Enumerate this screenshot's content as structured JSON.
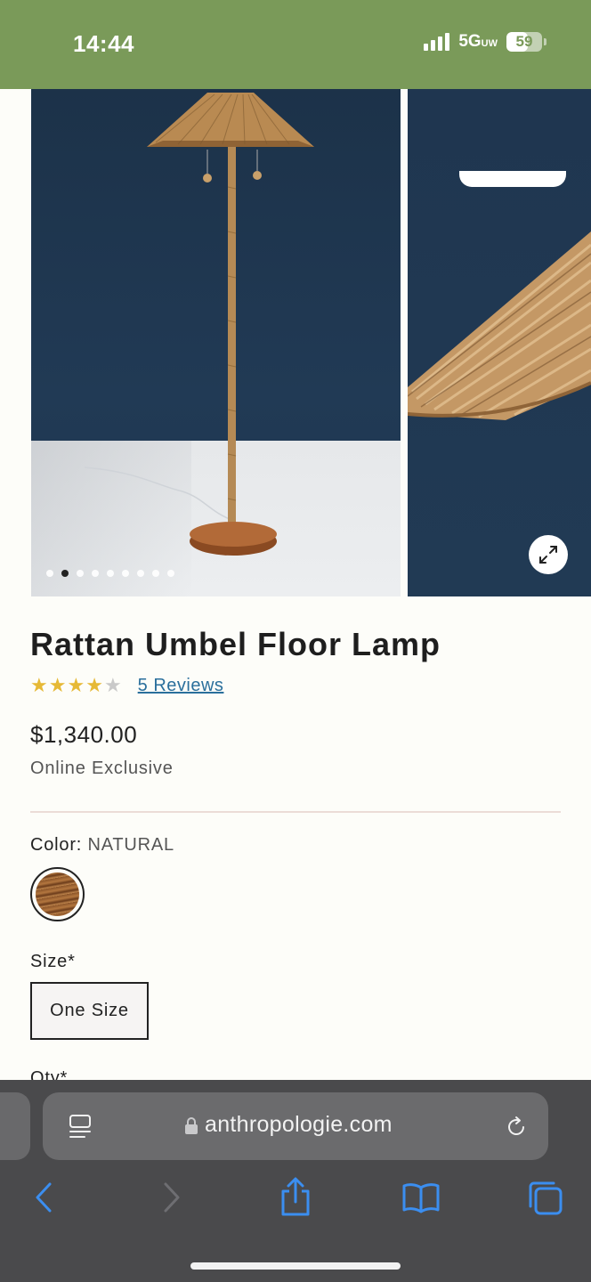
{
  "status_bar": {
    "time": "14:44",
    "network": "5G",
    "network_suffix": "UW",
    "battery": "59",
    "battery_level": 0.59,
    "background_color": "#7a9a59"
  },
  "gallery": {
    "dot_count": 9,
    "active_index": 1,
    "expand_icon": "expand-icon"
  },
  "product": {
    "title": "Rattan Umbel Floor Lamp",
    "rating": 4,
    "rating_max": 5,
    "reviews_link": "5 Reviews",
    "price": "$1,340.00",
    "availability": "Online Exclusive",
    "color_label": "Color:",
    "color_value": "NATURAL",
    "size_label": "Size*",
    "size_option": "One Size",
    "qty_label": "Qty*"
  },
  "browser": {
    "url": "anthropologie.com",
    "icons": [
      "reader-icon",
      "lock-icon",
      "reload-icon",
      "back-icon",
      "forward-icon",
      "share-icon",
      "bookmarks-icon",
      "tabs-icon"
    ],
    "accent": "#3b8ef0"
  }
}
